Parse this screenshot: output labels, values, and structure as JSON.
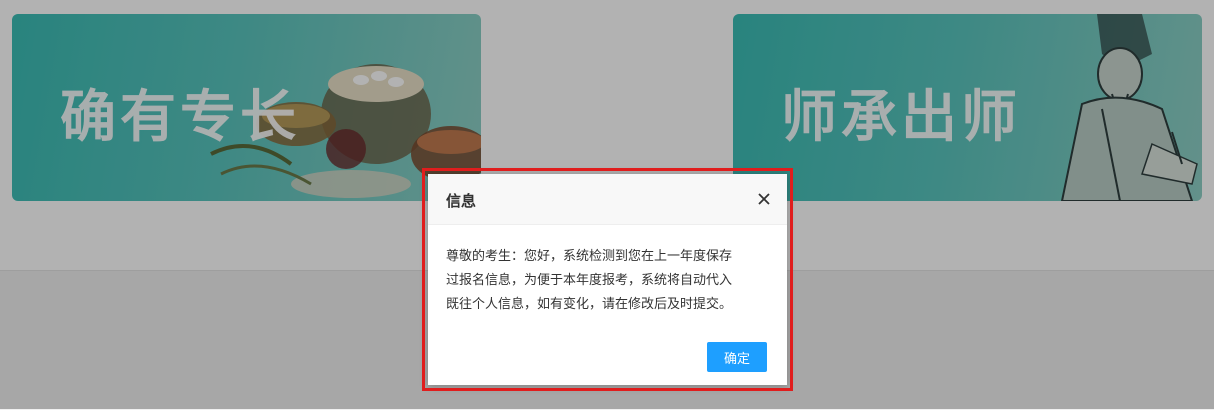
{
  "cards": {
    "left": {
      "title": "确有专长"
    },
    "right": {
      "title": "师承出师"
    }
  },
  "dialog": {
    "title": "信息",
    "lines": [
      "尊敬的考生：您好，系统检测到您在上一年度保存",
      "过报名信息，为便于本年度报考，系统将自动代入",
      "既往个人信息，如有变化，请在修改后及时提交。"
    ],
    "ok_label": "确定",
    "close_icon": "close-icon"
  },
  "colors": {
    "card_teal": "#3bbdb5",
    "button_blue": "#1e9fff",
    "highlight_red": "#e01d1d"
  }
}
